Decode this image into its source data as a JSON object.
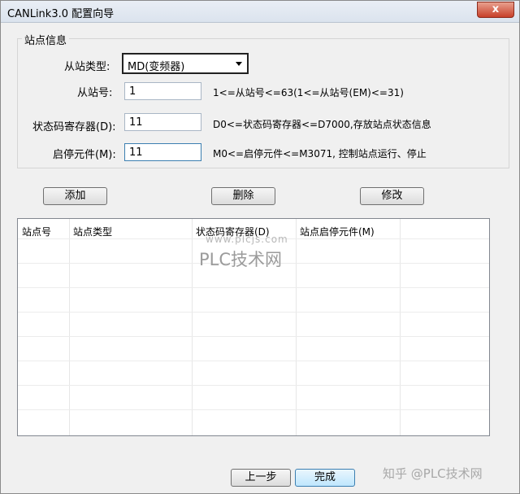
{
  "window": {
    "title": "CANLink3.0 配置向导",
    "close_glyph": "x"
  },
  "station_info": {
    "group_title": "站点信息",
    "slave_type_label": "从站类型:",
    "slave_type_value": "MD(变频器)",
    "slave_no_label": "从站号:",
    "slave_no_value": "1",
    "slave_no_hint": "1<=从站号<=63(1<=从站号(EM)<=31)",
    "status_reg_label": "状态码寄存器(D):",
    "status_reg_value": "11",
    "status_reg_hint": "D0<=状态码寄存器<=D7000,存放站点状态信息",
    "start_elem_label": "启停元件(M):",
    "start_elem_value": "11",
    "start_elem_hint": "M0<=启停元件<=M3071, 控制站点运行、停止"
  },
  "actions": {
    "add": "添加",
    "delete": "删除",
    "modify": "修改"
  },
  "table": {
    "columns": [
      "站点号",
      "站点类型",
      "状态码寄存器(D)",
      "站点启停元件(M)"
    ]
  },
  "footer": {
    "prev": "上一步",
    "finish": "完成"
  },
  "watermarks": {
    "url": "www.plcjs.com",
    "brand": "PLC技术网",
    "zhihu": "知乎 @PLC技术网"
  }
}
